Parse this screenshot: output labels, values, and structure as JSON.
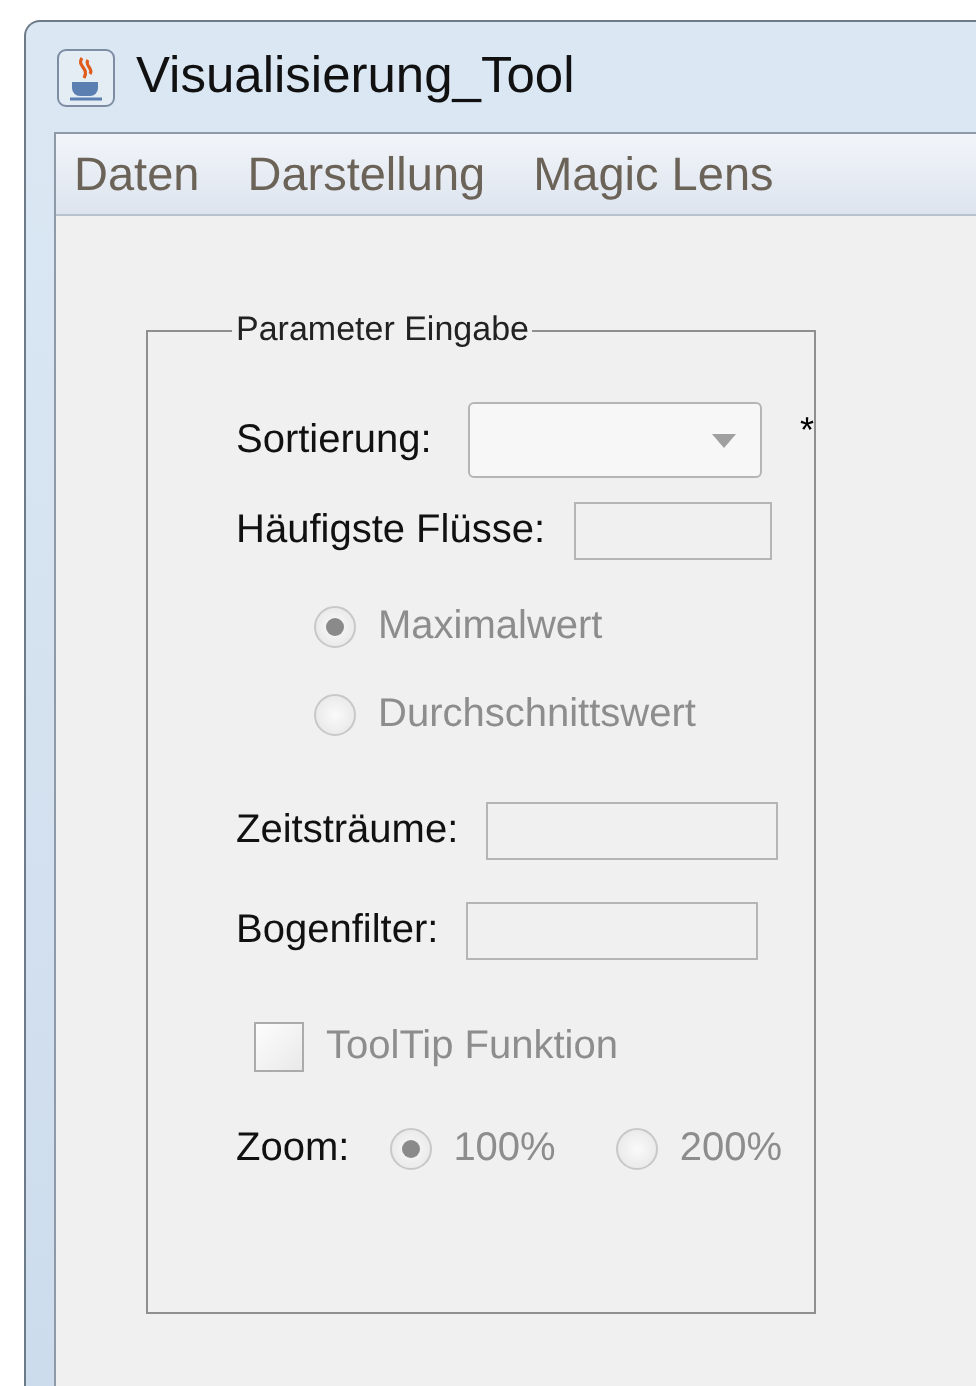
{
  "window": {
    "title": "Visualisierung_Tool"
  },
  "menu": [
    "Daten",
    "Darstellung",
    "Magic Lens"
  ],
  "group": {
    "title": "Parameter Eingabe",
    "rows": [
      {
        "kind": "combo",
        "label": "Sortierung:",
        "required_mark": "*"
      },
      {
        "kind": "field",
        "label": "Häufigste Flüsse:"
      },
      {
        "kind": "radio",
        "label": "Maximalwert",
        "selected": true,
        "disabled": true
      },
      {
        "kind": "radio",
        "label": "Durchschnittswert",
        "selected": false,
        "disabled": true
      },
      {
        "kind": "field",
        "label": "Zeitsträume:"
      },
      {
        "kind": "field",
        "label": "Bogenfilter:"
      },
      {
        "kind": "checkbox",
        "label": "ToolTip Funktion",
        "checked": false,
        "disabled": true
      },
      {
        "kind": "radio_group",
        "label": "Zoom:",
        "options": [
          {
            "label": "100%",
            "selected": true,
            "disabled": true
          },
          {
            "label": "200%",
            "selected": false,
            "disabled": true
          }
        ]
      }
    ]
  }
}
